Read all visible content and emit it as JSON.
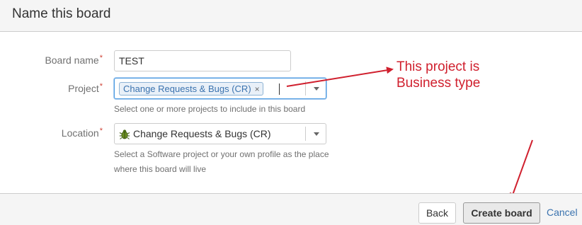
{
  "dialog": {
    "title": "Name this board"
  },
  "form": {
    "board_name": {
      "label": "Board name",
      "required_mark": "*",
      "value": "TEST"
    },
    "project": {
      "label": "Project",
      "required_mark": "*",
      "selected": "Change Requests & Bugs (CR)",
      "remove_glyph": "×",
      "help": "Select one or more projects to include in this board"
    },
    "location": {
      "label": "Location",
      "required_mark": "*",
      "value": "Change Requests & Bugs (CR)",
      "icon": "bug-icon",
      "help_line1": "Select a Software project or your own profile as the place",
      "help_line2": "where this board will live"
    }
  },
  "annotation": {
    "line1": "This project is",
    "line2": "Business type",
    "color": "#d0202e"
  },
  "footer": {
    "back_label": "Back",
    "create_label": "Create board",
    "cancel_label": "Cancel"
  }
}
